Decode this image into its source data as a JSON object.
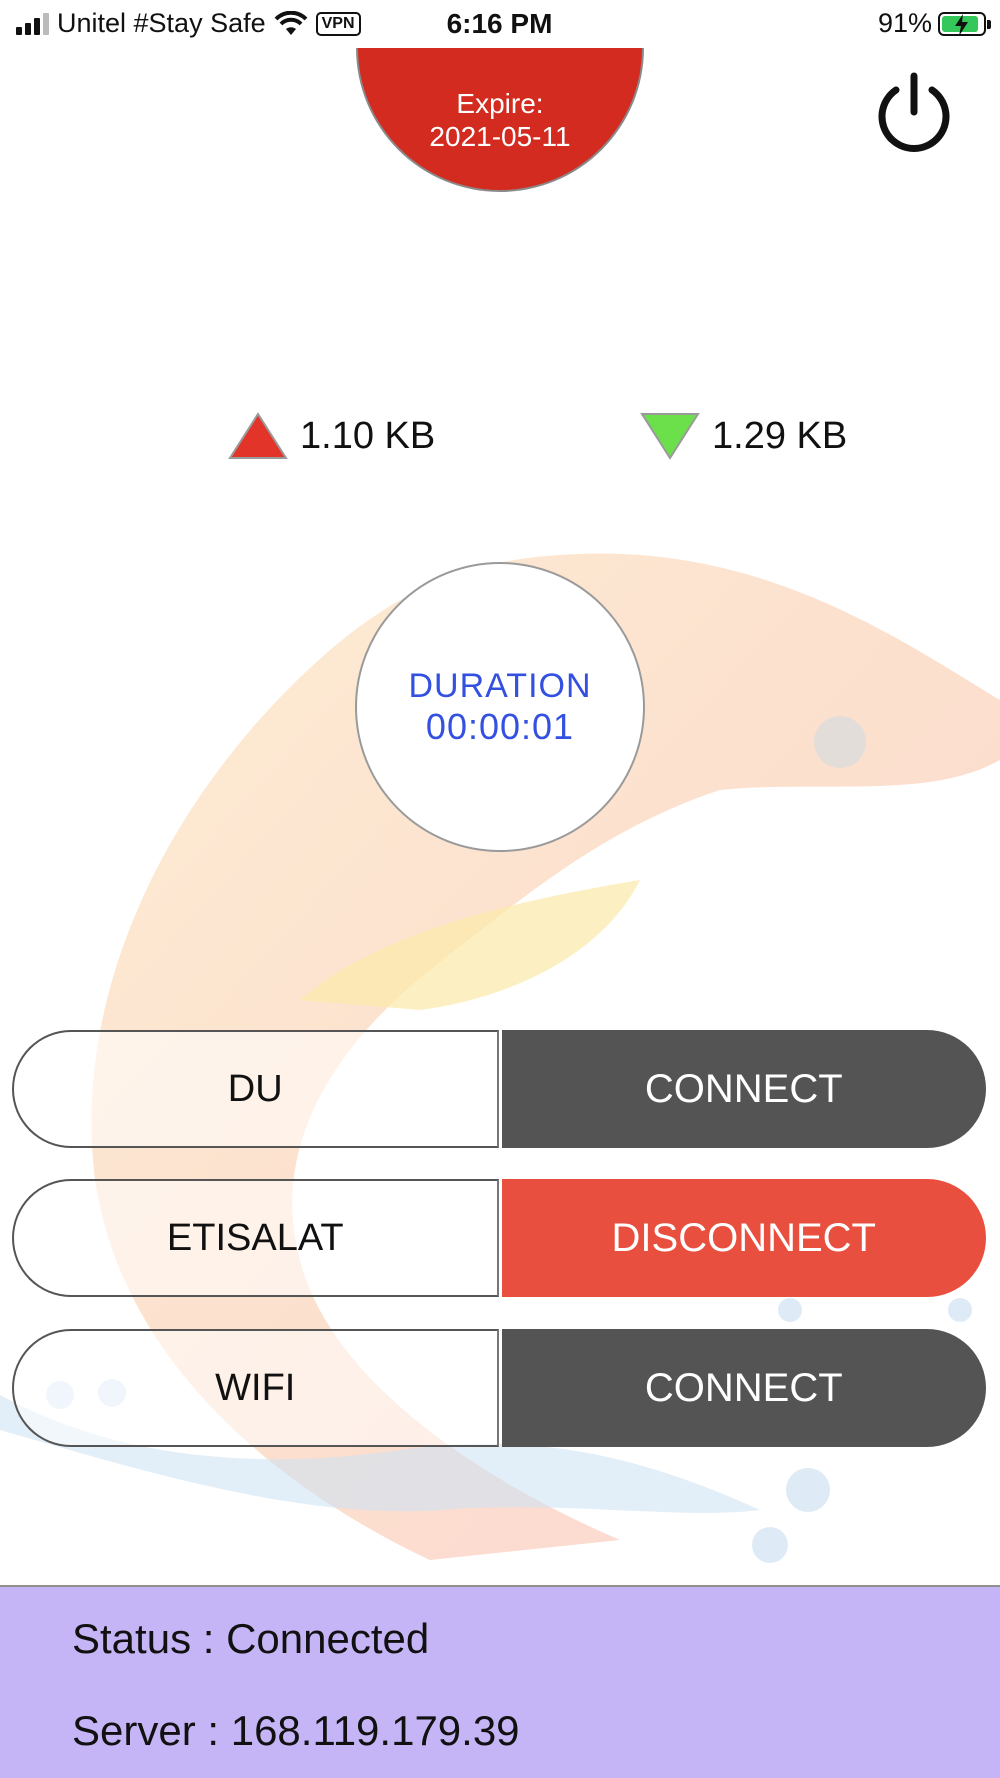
{
  "status_bar": {
    "carrier": "Unitel #Stay Safe",
    "vpn_badge": "VPN",
    "time": "6:16 PM",
    "battery_percent": "91%",
    "battery_level": 0.91,
    "battery_color": "#34c759"
  },
  "expire": {
    "label": "Expire:",
    "date": "2021-05-11",
    "color": "#d42b20"
  },
  "power_button": {
    "icon": "power-icon"
  },
  "traffic": {
    "upload": {
      "value": "1.10 KB",
      "icon": "upload-triangle-icon",
      "color": "#e3342a"
    },
    "download": {
      "value": "1.29 KB",
      "icon": "download-triangle-icon",
      "color": "#6be04a"
    }
  },
  "duration": {
    "label": "DURATION",
    "value": "00:00:01",
    "color": "#3350e0"
  },
  "connections": [
    {
      "name": "DU",
      "action": "CONNECT",
      "state": "disconnected"
    },
    {
      "name": "ETISALAT",
      "action": "DISCONNECT",
      "state": "connected"
    },
    {
      "name": "WIFI",
      "action": "CONNECT",
      "state": "disconnected"
    }
  ],
  "status_panel": {
    "status": "Status : Connected",
    "server": "Server : 168.119.179.39",
    "background": "#c5b5f6"
  }
}
